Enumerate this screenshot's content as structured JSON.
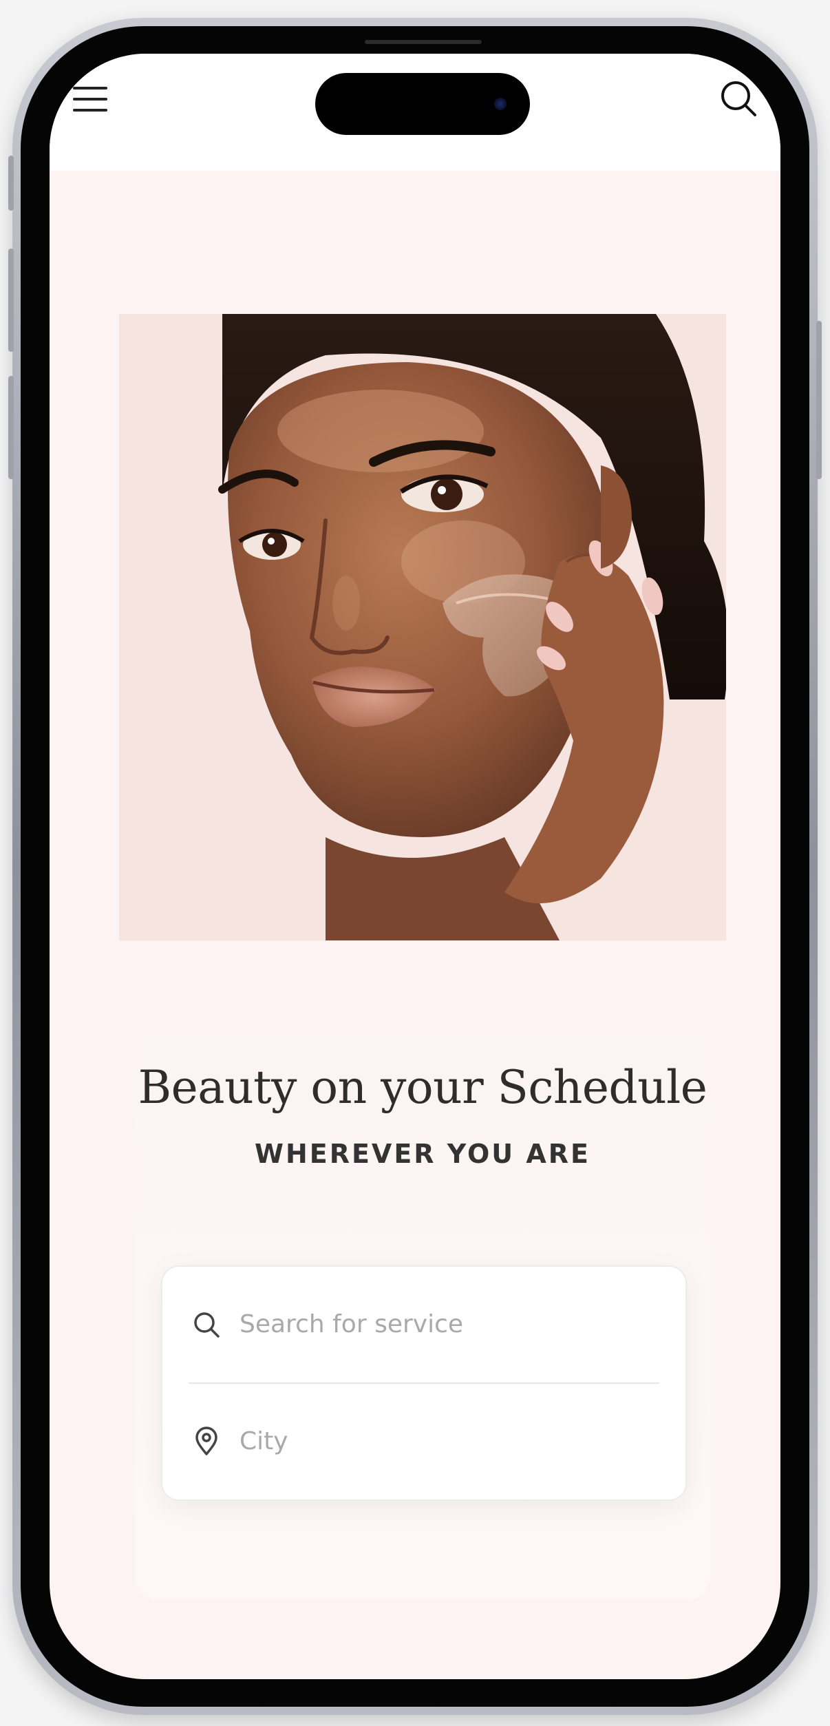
{
  "header": {
    "menu_icon": "hamburger-menu-icon",
    "search_icon": "search-icon"
  },
  "hero": {
    "image_subject": "woman applying skincare product"
  },
  "card": {
    "title": "Beauty on your Schedule",
    "subtitle": "WHEREVER YOU ARE"
  },
  "search_form": {
    "service_placeholder": "Search for service",
    "city_placeholder": "City"
  },
  "colors": {
    "screen_bg": "#fcf3f2",
    "hero_bg": "#f6e4e0",
    "text_dark": "#2f2c2c",
    "placeholder": "#a9a9a9"
  }
}
